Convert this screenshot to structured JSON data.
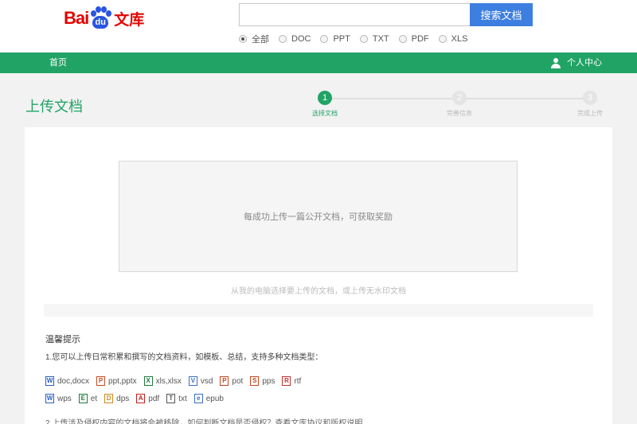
{
  "logo": {
    "bai": "Bai",
    "du": "du",
    "wenku": "文库"
  },
  "search": {
    "placeholder": "",
    "button_label": "搜索文档"
  },
  "filters": [
    {
      "label": "全部",
      "checked": true
    },
    {
      "label": "DOC",
      "checked": false
    },
    {
      "label": "PPT",
      "checked": false
    },
    {
      "label": "TXT",
      "checked": false
    },
    {
      "label": "PDF",
      "checked": false
    },
    {
      "label": "XLS",
      "checked": false
    }
  ],
  "nav": {
    "home": "首页",
    "user_center": "个人中心"
  },
  "page_title": "上传文档",
  "steps": [
    {
      "number": "1",
      "label": "选择文档"
    },
    {
      "number": "2",
      "label": "完善信息"
    },
    {
      "number": "3",
      "label": "完成上传"
    }
  ],
  "upload": {
    "drop_text": "每成功上传一篇公开文档，可获取奖励",
    "hint": "从我的电脑选择要上传的文档，或上传无水印文档"
  },
  "tips": {
    "title": "温馨提示",
    "line1": "1.您可以上传日常积累和撰写的文档资料，如模板、总结，支持多种文档类型：",
    "file_types_row1": [
      {
        "icon": "word-icon",
        "glyph": "W",
        "color": "#2b5fc7",
        "label": "doc,docx"
      },
      {
        "icon": "ppt-icon",
        "glyph": "P",
        "color": "#d04a1f",
        "label": "ppt,pptx"
      },
      {
        "icon": "excel-icon",
        "glyph": "X",
        "color": "#1e7a3c",
        "label": "xls,xlsx"
      },
      {
        "icon": "visio-icon",
        "glyph": "V",
        "color": "#3b6fc0",
        "label": "vsd"
      },
      {
        "icon": "pot-icon",
        "glyph": "P",
        "color": "#c8461e",
        "label": "pot"
      },
      {
        "icon": "pps-icon",
        "glyph": "S",
        "color": "#c8461e",
        "label": "pps"
      },
      {
        "icon": "rtf-icon",
        "glyph": "R",
        "color": "#c43030",
        "label": "rtf"
      }
    ],
    "file_types_row2": [
      {
        "icon": "wps-icon",
        "glyph": "W",
        "color": "#2b5fc7",
        "label": "wps"
      },
      {
        "icon": "et-icon",
        "glyph": "E",
        "color": "#1e7a3c",
        "label": "et"
      },
      {
        "icon": "dps-icon",
        "glyph": "D",
        "color": "#d08a1f",
        "label": "dps"
      },
      {
        "icon": "pdf-icon",
        "glyph": "A",
        "color": "#c42020",
        "label": "pdf"
      },
      {
        "icon": "txt-icon",
        "glyph": "T",
        "color": "#555555",
        "label": "txt"
      },
      {
        "icon": "epub-icon",
        "glyph": "e",
        "color": "#3b6fc0",
        "label": "epub"
      }
    ],
    "line2": "2.上传涉及侵权内容的文档将会被移除，如何判断文档是否侵权？查看文库协议和版权说明"
  },
  "colors": {
    "brand_green": "#21a366",
    "logo_red": "#e10602",
    "logo_blue": "#2a55e0",
    "search_blue": "#3d7fe0"
  }
}
